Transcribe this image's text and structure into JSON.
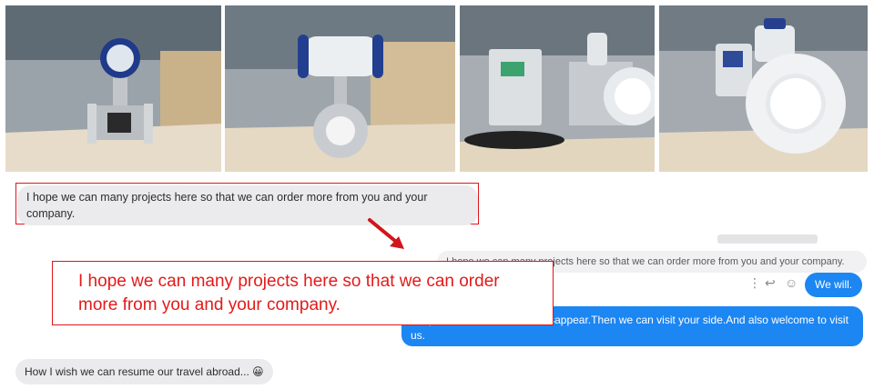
{
  "photos": [
    {
      "name": "flowmeter-photo-1",
      "alt": ""
    },
    {
      "name": "flowmeter-photo-2",
      "alt": ""
    },
    {
      "name": "flowmeter-photo-3",
      "alt": ""
    },
    {
      "name": "flowmeter-photo-4",
      "alt": ""
    }
  ],
  "chat": {
    "incoming_1": "I hope we can many projects here so that we can order more from you and your company.",
    "quoted_reply": "I hope we can many projects here so that we can order more from you and your company.",
    "reply_we_will": "We will.",
    "outgoing_1": "I hope the Covid can soon disappear.Then we can visit your side.And also welcome to visit us.",
    "incoming_2": "How I wish we can resume our travel abroad... 😀"
  },
  "annotation": {
    "callout_text": "I hope we can many projects here so that we can order more from you and your company.",
    "accent_color": "#e0151b"
  },
  "colors": {
    "bubble_in": "#ebebee",
    "bubble_out": "#1c86f2"
  },
  "icons": [
    "more-vertical-icon",
    "reply-icon",
    "emoji-icon",
    "arrow-icon"
  ]
}
